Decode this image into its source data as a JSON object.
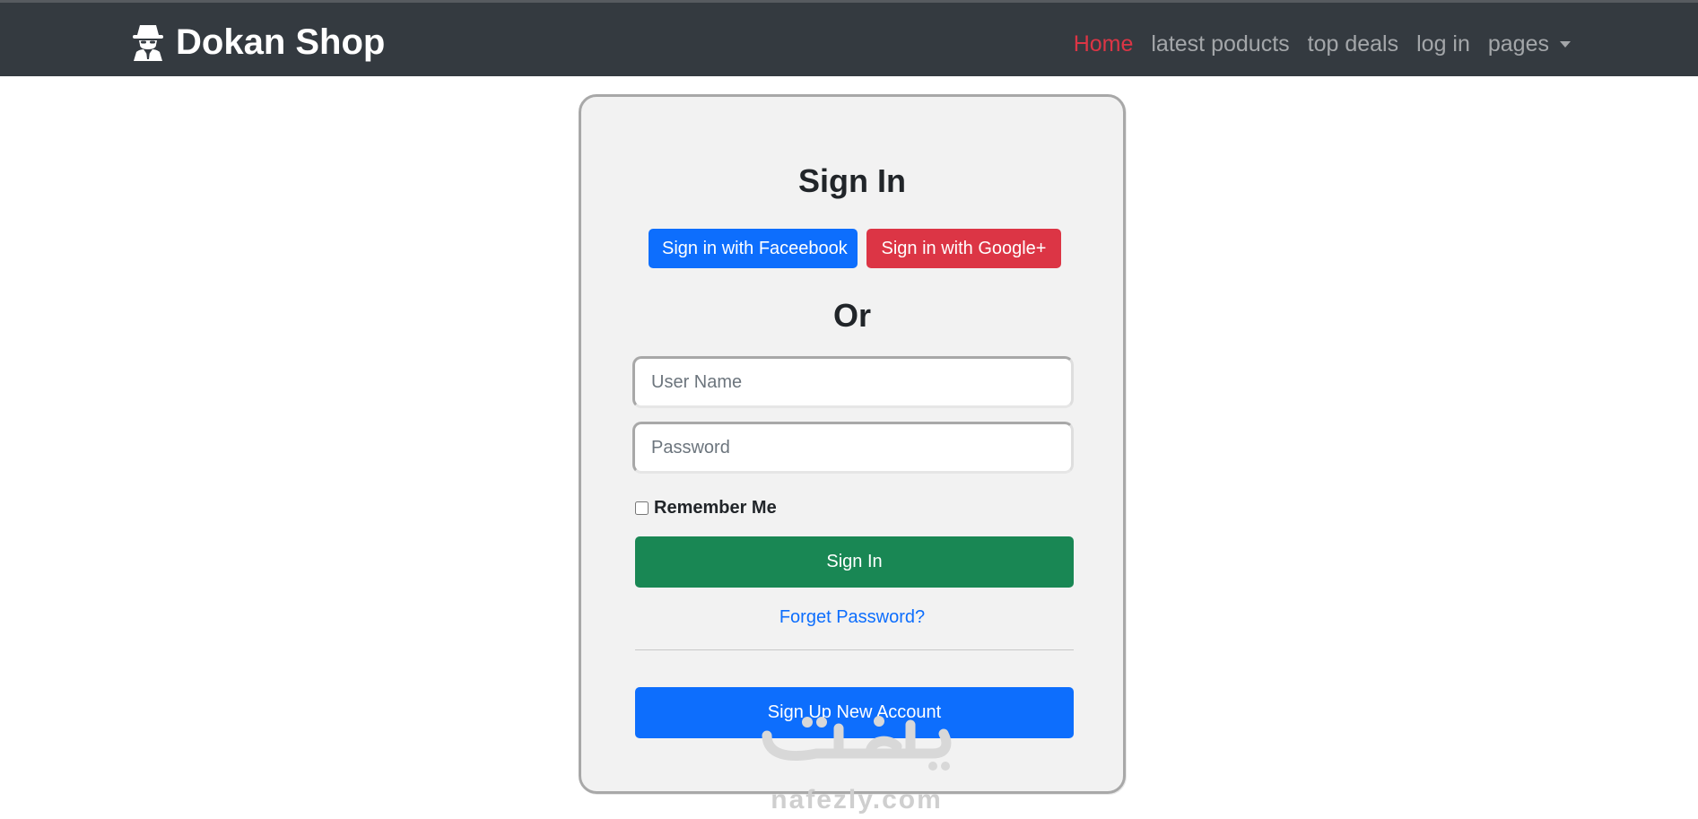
{
  "brand": {
    "name": "Dokan Shop",
    "icon": "spy-icon"
  },
  "nav": {
    "items": [
      {
        "label": "Home",
        "active": true
      },
      {
        "label": "latest poducts",
        "active": false
      },
      {
        "label": "top deals",
        "active": false
      },
      {
        "label": "log in",
        "active": false
      },
      {
        "label": "pages",
        "active": false,
        "dropdown": true
      }
    ]
  },
  "signin": {
    "title": "Sign In",
    "facebook_label": "Sign in with Faceebook",
    "google_label": "Sign in with Google+",
    "or_label": "Or",
    "username_placeholder": "User Name",
    "password_placeholder": "Password",
    "remember_label": "Remember Me",
    "submit_label": "Sign In",
    "forget_label": "Forget Password?",
    "signup_label": "Sign Up New Account"
  },
  "watermark": {
    "text": "nafezly.com"
  },
  "colors": {
    "navbar": "#343a40",
    "active": "#dc3545",
    "facebook": "#0d6efd",
    "google": "#dc3545",
    "success": "#198754",
    "primary": "#0d6efd"
  }
}
